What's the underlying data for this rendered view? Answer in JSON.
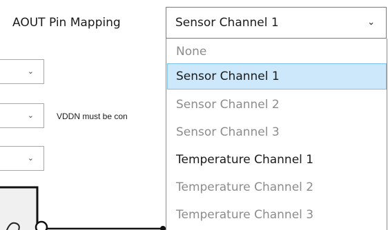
{
  "field": {
    "label": "AOUT Pin Mapping",
    "selected_value": "Sensor Channel 1"
  },
  "dropdown": {
    "options": [
      {
        "label": "None",
        "enabled": false,
        "selected": false
      },
      {
        "label": "Sensor Channel 1",
        "enabled": true,
        "selected": true
      },
      {
        "label": "Sensor Channel 2",
        "enabled": false,
        "selected": false
      },
      {
        "label": "Sensor Channel 3",
        "enabled": false,
        "selected": false
      },
      {
        "label": "Temperature Channel 1",
        "enabled": true,
        "selected": false
      },
      {
        "label": "Temperature Channel 2",
        "enabled": false,
        "selected": false
      },
      {
        "label": "Temperature Channel 3",
        "enabled": false,
        "selected": false
      }
    ]
  },
  "background": {
    "note_text": "VDDN must be con"
  },
  "colors": {
    "selection_highlight": "#cce8fa",
    "selection_border": "#7ac0ef",
    "disabled_text": "#8c8c8c"
  },
  "icons": {
    "dropdown_arrow": "chevron-down-icon"
  }
}
